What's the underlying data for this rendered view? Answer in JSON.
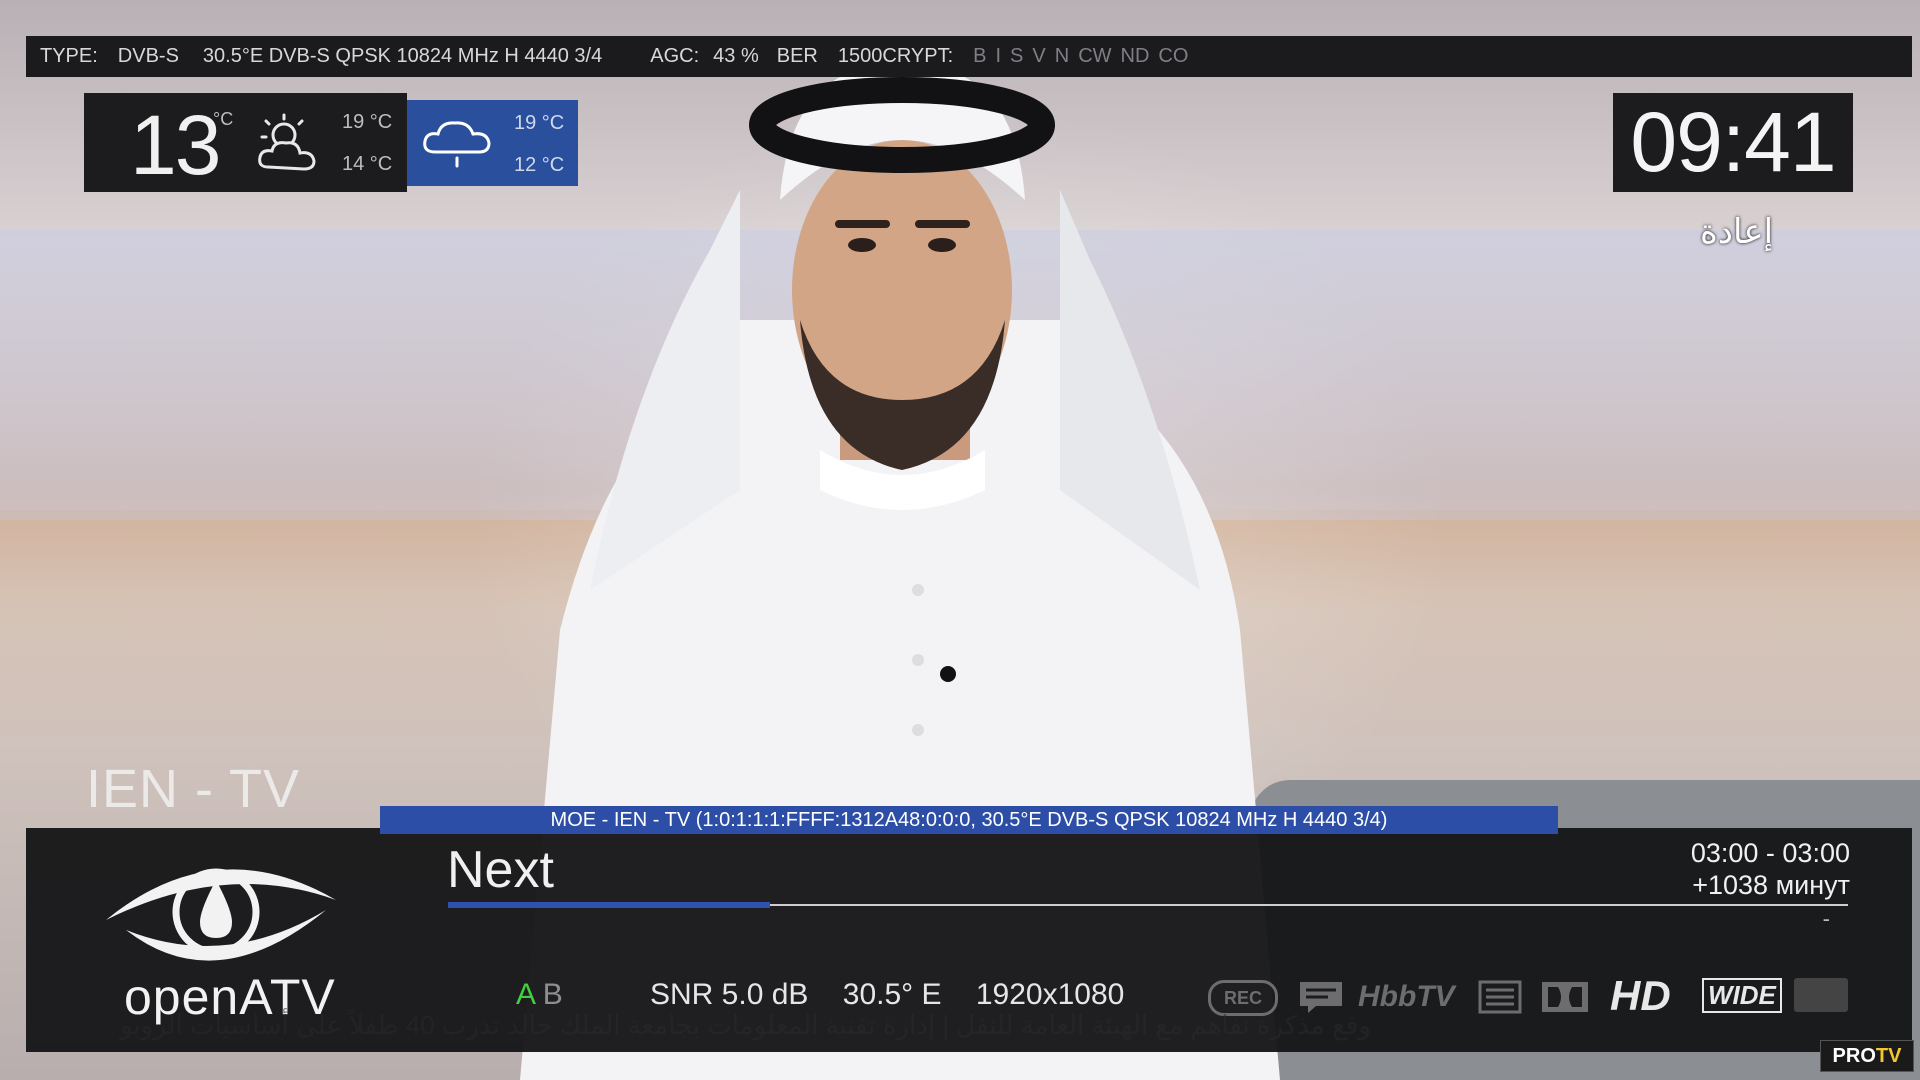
{
  "info_bar": {
    "type_label": "TYPE:",
    "type_value": "DVB-S",
    "transponder": "30.5°E DVB-S QPSK 10824 MHz H 4440 3/4",
    "agc_label": "AGC:",
    "agc_value": "43 %",
    "ber_label": "BER",
    "ber_value": "1500",
    "crypt_label": "CRYPT:",
    "crypt_systems": [
      "B",
      "I",
      "S",
      "V",
      "N",
      "CW",
      "ND",
      "CO"
    ]
  },
  "weather": {
    "current_temp": "13",
    "current_unit": "°C",
    "current_icon": "partly-cloudy-icon",
    "today_high": "19 °C",
    "today_low": "14 °C",
    "next_icon": "rain-cloud-icon",
    "next_high": "19 °C",
    "next_low": "12 °C"
  },
  "clock": "09:41",
  "broadcaster_logo_text": "إعادة",
  "channel_name": "IEN - TV",
  "service_line": "MOE - IEN - TV (1:0:1:1:1:FFFF:1312A48:0:0:0, 30.5°E DVB-S QPSK 10824 MHz H 4440 3/4)",
  "event": {
    "title": "Next",
    "time_range": "03:00  -  03:00",
    "remaining": "+1038 минут",
    "dash": "-",
    "progress": 0.23
  },
  "brand": "openATV",
  "audio_tracks": {
    "a": "A",
    "b": "B"
  },
  "tech": {
    "snr": "SNR  5.0 dB",
    "orbital": "30.5° E",
    "resolution": "1920x1080"
  },
  "badges": {
    "rec": "REC",
    "hbbtv": "HbbTV",
    "hd": "HD",
    "wide": "WIDE"
  },
  "ticker": "وقع مذكرة تفاهم مع الهيئة العامة للنقل  |  إدارة تقنية المعلومات بجامعة الملك خالد تدرب 40 طفلاً على أساسيات الروبو",
  "watermark": {
    "pro": "PRO",
    "tv": "TV"
  },
  "colors": {
    "accent_blue": "#2c4ea6",
    "panel_bg": "#161618",
    "ab_active": "#3fcf3f"
  }
}
